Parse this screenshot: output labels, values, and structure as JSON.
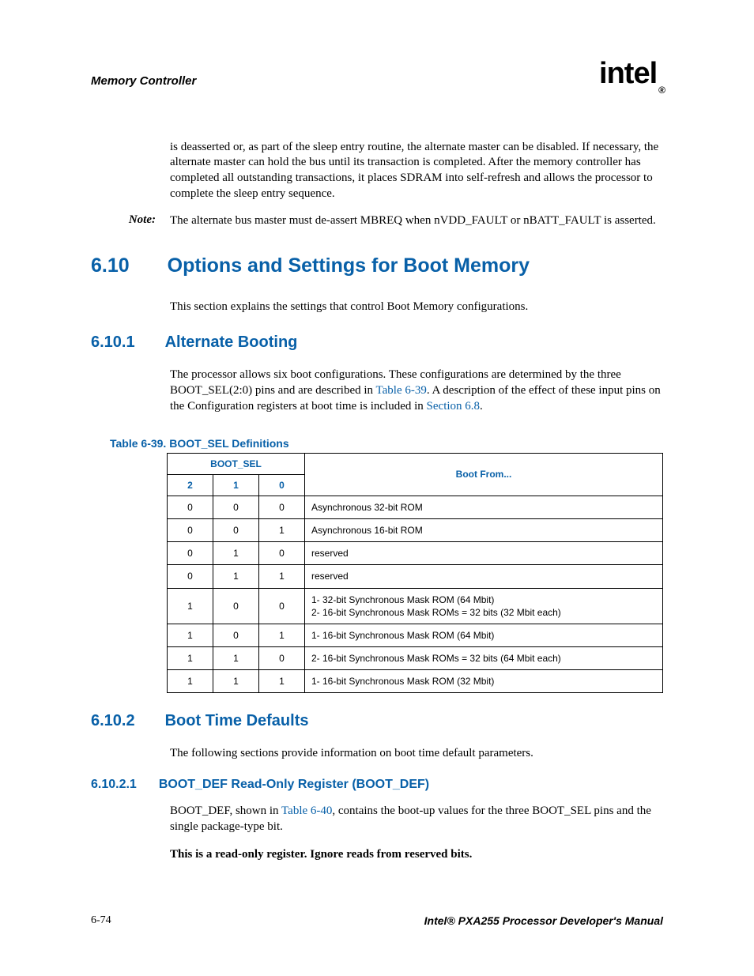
{
  "header": {
    "section": "Memory Controller",
    "logo": "intel",
    "logo_sub": "®"
  },
  "para_intro": "is deasserted or, as part of the sleep entry routine, the alternate master can be disabled. If necessary, the alternate master can hold the bus until its transaction is completed. After the memory controller has completed all outstanding transactions, it places SDRAM into self-refresh and allows the processor to complete the sleep entry sequence.",
  "note": {
    "label": "Note:",
    "text": "The alternate bus master must de-assert MBREQ when nVDD_FAULT or nBATT_FAULT is asserted."
  },
  "h1": {
    "num": "6.10",
    "text": "Options and Settings for Boot Memory"
  },
  "h1_para": "This section explains the settings that control Boot Memory configurations.",
  "h2a": {
    "num": "6.10.1",
    "text": "Alternate Booting"
  },
  "h2a_para_pre": "The processor allows six boot configurations. These configurations are determined by the three BOOT_SEL(2:0) pins and are described in ",
  "h2a_link1": "Table 6-39",
  "h2a_para_mid": ". A description of the effect of these input pins on the Configuration registers at boot time is included in ",
  "h2a_link2": "Section 6.8",
  "h2a_para_end": ".",
  "table": {
    "caption": "Table 6-39. BOOT_SEL Definitions",
    "head_group": "BOOT_SEL",
    "head_bootfrom": "Boot From...",
    "head_cols": [
      "2",
      "1",
      "0"
    ],
    "rows": [
      {
        "c": [
          "0",
          "0",
          "0"
        ],
        "d": "Asynchronous 32-bit ROM"
      },
      {
        "c": [
          "0",
          "0",
          "1"
        ],
        "d": "Asynchronous 16-bit ROM"
      },
      {
        "c": [
          "0",
          "1",
          "0"
        ],
        "d": "reserved"
      },
      {
        "c": [
          "0",
          "1",
          "1"
        ],
        "d": "reserved"
      },
      {
        "c": [
          "1",
          "0",
          "0"
        ],
        "d": "1- 32-bit Synchronous Mask ROM (64 Mbit)\n2- 16-bit Synchronous Mask ROMs = 32 bits (32 Mbit each)"
      },
      {
        "c": [
          "1",
          "0",
          "1"
        ],
        "d": "1- 16-bit Synchronous Mask ROM (64 Mbit)"
      },
      {
        "c": [
          "1",
          "1",
          "0"
        ],
        "d": "2- 16-bit Synchronous Mask ROMs = 32 bits (64 Mbit each)"
      },
      {
        "c": [
          "1",
          "1",
          "1"
        ],
        "d": "1- 16-bit Synchronous Mask ROM (32 Mbit)"
      }
    ]
  },
  "h2b": {
    "num": "6.10.2",
    "text": "Boot Time Defaults"
  },
  "h2b_para": "The following sections provide information on boot time default parameters.",
  "h3": {
    "num": "6.10.2.1",
    "text": "BOOT_DEF Read-Only Register (BOOT_DEF)"
  },
  "h3_para_pre": "BOOT_DEF, shown in ",
  "h3_link": "Table 6-40",
  "h3_para_post": ", contains the boot-up values for the three BOOT_SEL pins and the single package-type bit.",
  "h3_bold": "This is a read-only register. Ignore reads from reserved bits.",
  "footer": {
    "left": "6-74",
    "right": "Intel® PXA255 Processor Developer's Manual"
  }
}
